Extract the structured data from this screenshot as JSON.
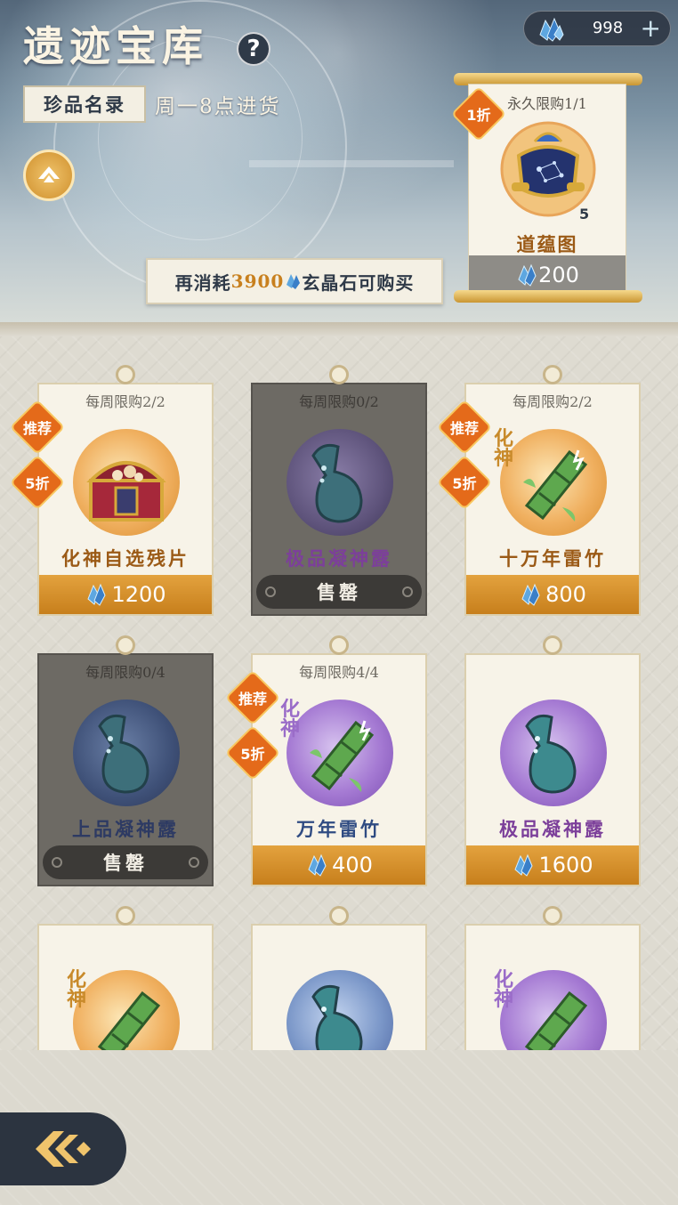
{
  "header": {
    "title": "遗迹宝库",
    "help_icon": "question-icon",
    "catalog_tab": "珍品名录",
    "restock_text": "周一8点进货",
    "currency": {
      "icon": "crystal-icon",
      "value": "998",
      "plus_icon": "plus-icon"
    },
    "spend_banner": {
      "prefix": "再消耗",
      "amount": "3900",
      "suffix": "玄晶石可购买"
    }
  },
  "featured": {
    "limit": "永久限购1/1",
    "discount": "1折",
    "name": "道蕴图",
    "quantity": "5",
    "price": "200"
  },
  "items": [
    {
      "limit": "每周限购2/2",
      "recommend": "推荐",
      "discount": "5折",
      "name": "化神自选残片",
      "price": "1200",
      "sold_out": false
    },
    {
      "limit": "每周限购0/2",
      "name": "极品凝神露",
      "status": "售罄",
      "sold_out": true
    },
    {
      "limit": "每周限购2/2",
      "recommend": "推荐",
      "discount": "5折",
      "realm": "化神",
      "name": "十万年雷竹",
      "price": "800",
      "sold_out": false
    },
    {
      "limit": "每周限购0/4",
      "name": "上品凝神露",
      "status": "售罄",
      "sold_out": true
    },
    {
      "limit": "每周限购4/4",
      "recommend": "推荐",
      "discount": "5折",
      "realm": "化神",
      "name": "万年雷竹",
      "price": "400",
      "sold_out": false
    },
    {
      "name": "极品凝神露",
      "price": "1600",
      "sold_out": false
    },
    {
      "realm": "化神"
    },
    {},
    {
      "realm": "化神"
    }
  ],
  "colors": {
    "accent_orange": "#e46a1a",
    "price_bar": "#d68f2c",
    "header_text": "#fbf4e3",
    "dark": "#2c3440"
  }
}
